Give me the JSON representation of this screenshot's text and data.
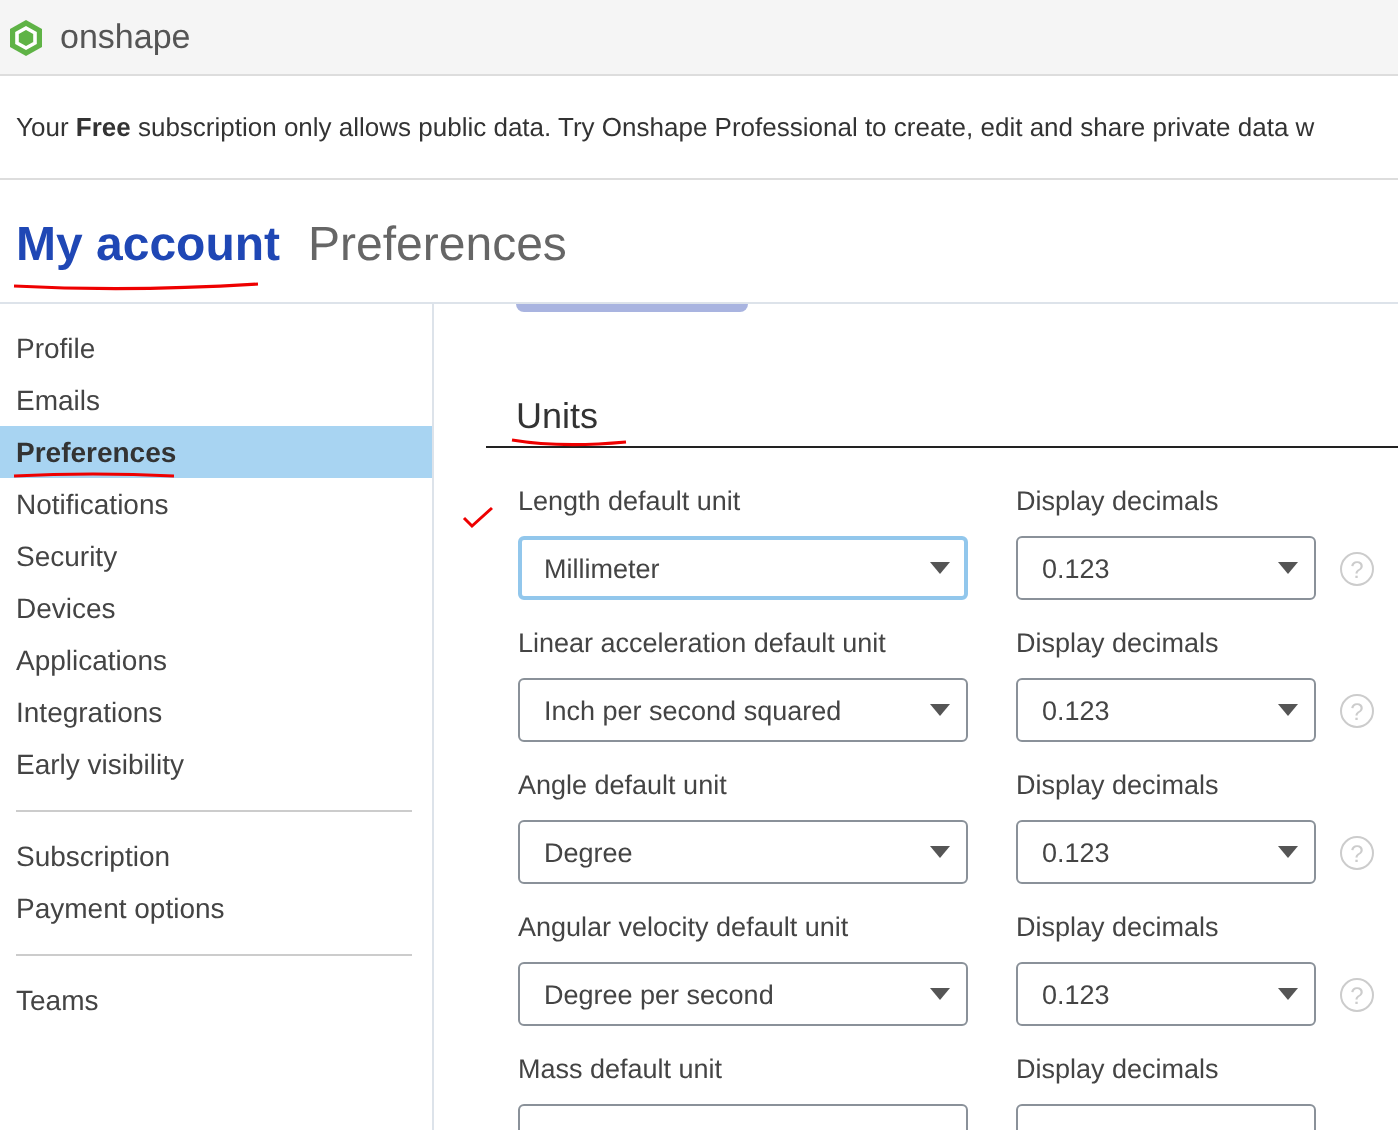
{
  "app": {
    "logo_text": "onshape"
  },
  "banner": {
    "text": "Your **Free** subscription only allows public data. Try Onshape Professional to create, edit and share private data w"
  },
  "tabs": [
    {
      "label": "My account",
      "selected": true
    },
    {
      "label": "Preferences",
      "selected": false
    }
  ],
  "sidebar": {
    "groups": [
      {
        "items": [
          {
            "label": "Profile",
            "selected": false
          },
          {
            "label": "Emails",
            "selected": false
          },
          {
            "label": "Preferences",
            "selected": true
          },
          {
            "label": "Notifications",
            "selected": false
          },
          {
            "label": "Security",
            "selected": false
          },
          {
            "label": "Devices",
            "selected": false
          },
          {
            "label": "Applications",
            "selected": false
          },
          {
            "label": "Integrations",
            "selected": false
          },
          {
            "label": "Early visibility",
            "selected": false
          }
        ]
      },
      {
        "items": [
          {
            "label": "Subscription",
            "selected": false
          },
          {
            "label": "Payment options",
            "selected": false
          }
        ]
      },
      {
        "items": [
          {
            "label": "Teams",
            "selected": false
          }
        ]
      }
    ]
  },
  "section": {
    "title": "Units",
    "rows": [
      {
        "label": "Length default unit",
        "value": "Millimeter",
        "focused": true,
        "decimals_label": "Display decimals",
        "decimals": "0.123",
        "help": "?"
      },
      {
        "label": "Linear acceleration default unit",
        "value": "Inch per second squared",
        "focused": false,
        "decimals_label": "Display decimals",
        "decimals": "0.123",
        "help": "?"
      },
      {
        "label": "Angle default unit",
        "value": "Degree",
        "focused": false,
        "decimals_label": "Display decimals",
        "decimals": "0.123",
        "help": "?"
      },
      {
        "label": "Angular velocity default unit",
        "value": "Degree per second",
        "focused": false,
        "decimals_label": "Display decimals",
        "decimals": "0.123",
        "help": "?"
      },
      {
        "label": "Mass default unit",
        "focused": false,
        "decimals_label": "Display decimals"
      }
    ]
  }
}
